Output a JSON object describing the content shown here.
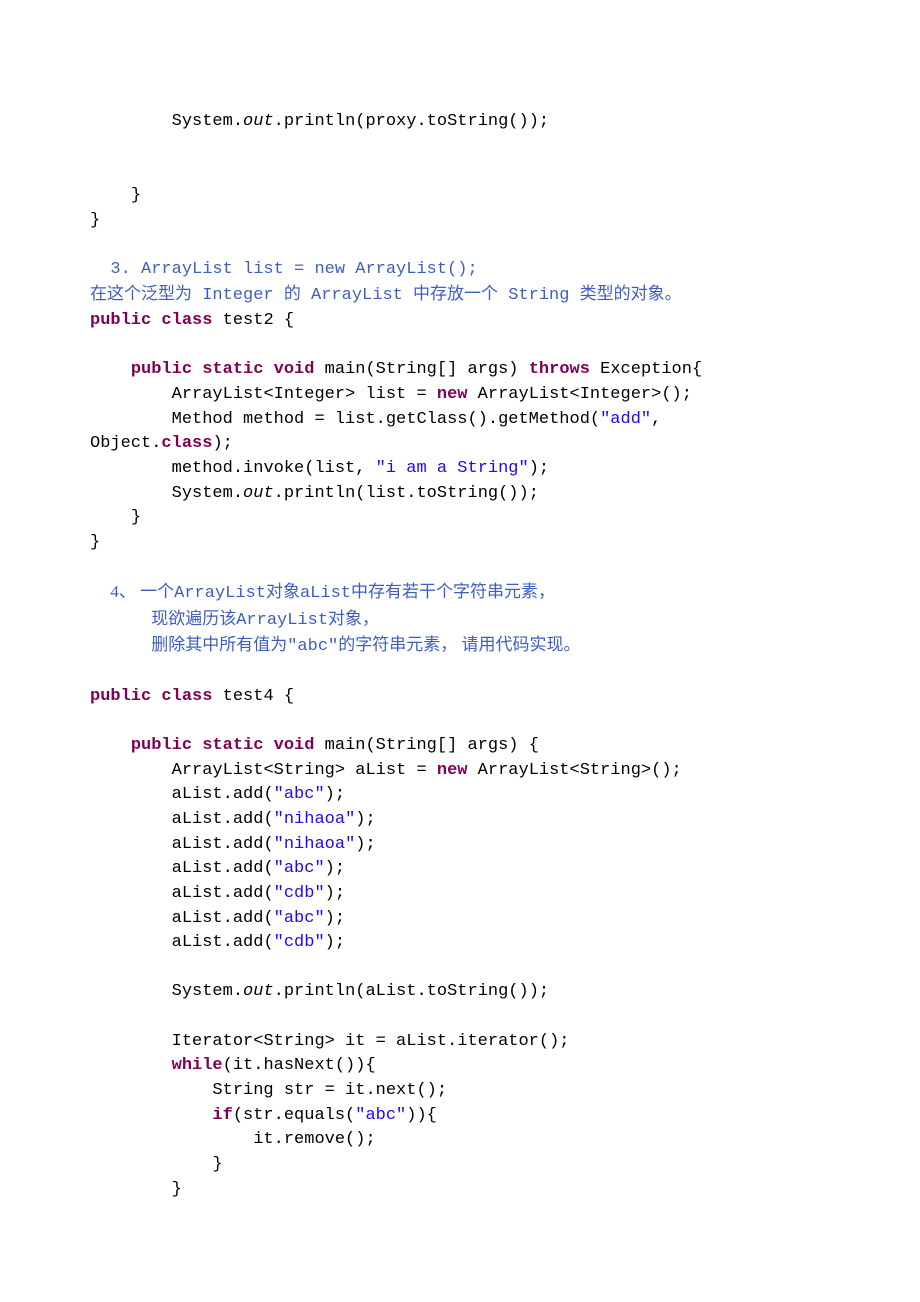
{
  "lines": [
    {
      "indent": 2,
      "parts": [
        {
          "t": "System."
        },
        {
          "t": "out",
          "cls": "it"
        },
        {
          "t": ".println(proxy.toString());"
        }
      ]
    },
    {
      "indent": 0,
      "parts": [
        {
          "t": ""
        }
      ]
    },
    {
      "indent": 0,
      "parts": [
        {
          "t": ""
        }
      ]
    },
    {
      "indent": 1,
      "parts": [
        {
          "t": "}"
        }
      ]
    },
    {
      "indent": 0,
      "parts": [
        {
          "t": "}"
        }
      ]
    },
    {
      "indent": 0,
      "parts": [
        {
          "t": ""
        }
      ]
    },
    {
      "indent": 0,
      "leading": "  ",
      "parts": [
        {
          "t": "3. ArrayList list = new ArrayList();",
          "cls": "bluecm"
        }
      ]
    },
    {
      "indent": 0,
      "mixed": true,
      "parts": [
        {
          "t": "在这个泛型为",
          "cls": "bluecm cjk"
        },
        {
          "t": " Integer ",
          "cls": "bluecm"
        },
        {
          "t": "的",
          "cls": "bluecm cjk"
        },
        {
          "t": " ArrayList ",
          "cls": "bluecm"
        },
        {
          "t": "中存放一个",
          "cls": "bluecm cjk"
        },
        {
          "t": " String ",
          "cls": "bluecm"
        },
        {
          "t": "类型的对象。",
          "cls": "bluecm cjk"
        }
      ]
    },
    {
      "indent": 0,
      "parts": [
        {
          "t": "public",
          "cls": "kw"
        },
        {
          "t": " "
        },
        {
          "t": "class",
          "cls": "kw"
        },
        {
          "t": " test2 {"
        }
      ]
    },
    {
      "indent": 0,
      "parts": [
        {
          "t": ""
        }
      ]
    },
    {
      "indent": 1,
      "parts": [
        {
          "t": "public",
          "cls": "kw"
        },
        {
          "t": " "
        },
        {
          "t": "static",
          "cls": "kw"
        },
        {
          "t": " "
        },
        {
          "t": "void",
          "cls": "kw"
        },
        {
          "t": " main(String[] args) "
        },
        {
          "t": "throws",
          "cls": "kw"
        },
        {
          "t": " Exception{"
        }
      ]
    },
    {
      "indent": 2,
      "parts": [
        {
          "t": "ArrayList<Integer> list = "
        },
        {
          "t": "new",
          "cls": "kw"
        },
        {
          "t": " ArrayList<Integer>();"
        }
      ]
    },
    {
      "indent": 2,
      "parts": [
        {
          "t": "Method method = list.getClass().getMethod("
        },
        {
          "t": "\"add\"",
          "cls": "str"
        },
        {
          "t": ", "
        }
      ]
    },
    {
      "indent": 0,
      "parts": [
        {
          "t": "Object."
        },
        {
          "t": "class",
          "cls": "kw"
        },
        {
          "t": ");"
        }
      ]
    },
    {
      "indent": 2,
      "parts": [
        {
          "t": "method.invoke(list, "
        },
        {
          "t": "\"i am a String\"",
          "cls": "str"
        },
        {
          "t": ");"
        }
      ]
    },
    {
      "indent": 2,
      "parts": [
        {
          "t": "System."
        },
        {
          "t": "out",
          "cls": "it"
        },
        {
          "t": ".println(list.toString());"
        }
      ]
    },
    {
      "indent": 1,
      "parts": [
        {
          "t": "}"
        }
      ]
    },
    {
      "indent": 0,
      "parts": [
        {
          "t": "}"
        }
      ]
    },
    {
      "indent": 0,
      "parts": [
        {
          "t": ""
        }
      ]
    },
    {
      "indent": 0,
      "leading": "  ",
      "mixed": true,
      "parts": [
        {
          "t": "4、 一个",
          "cls": "bluecm cjk"
        },
        {
          "t": "ArrayList",
          "cls": "bluecm"
        },
        {
          "t": "对象",
          "cls": "bluecm cjk"
        },
        {
          "t": "aList",
          "cls": "bluecm"
        },
        {
          "t": "中存有若干个字符串元素，",
          "cls": "bluecm cjk"
        }
      ]
    },
    {
      "indent": 0,
      "leading": "      ",
      "mixed": true,
      "parts": [
        {
          "t": "现欲遍历该",
          "cls": "bluecm cjk"
        },
        {
          "t": "ArrayList",
          "cls": "bluecm"
        },
        {
          "t": "对象，",
          "cls": "bluecm cjk"
        }
      ]
    },
    {
      "indent": 0,
      "leading": "      ",
      "mixed": true,
      "parts": [
        {
          "t": "删除其中所有值为",
          "cls": "bluecm cjk"
        },
        {
          "t": "\"abc\"",
          "cls": "bluecm"
        },
        {
          "t": "的字符串元素， 请用代码实现。",
          "cls": "bluecm cjk"
        }
      ]
    },
    {
      "indent": 0,
      "parts": [
        {
          "t": ""
        }
      ]
    },
    {
      "indent": 0,
      "parts": [
        {
          "t": "public",
          "cls": "kw"
        },
        {
          "t": " "
        },
        {
          "t": "class",
          "cls": "kw"
        },
        {
          "t": " test4 {"
        }
      ]
    },
    {
      "indent": 0,
      "parts": [
        {
          "t": ""
        }
      ]
    },
    {
      "indent": 1,
      "parts": [
        {
          "t": "public",
          "cls": "kw"
        },
        {
          "t": " "
        },
        {
          "t": "static",
          "cls": "kw"
        },
        {
          "t": " "
        },
        {
          "t": "void",
          "cls": "kw"
        },
        {
          "t": " main(String[] args) {"
        }
      ]
    },
    {
      "indent": 2,
      "parts": [
        {
          "t": "ArrayList<String> aList = "
        },
        {
          "t": "new",
          "cls": "kw"
        },
        {
          "t": " ArrayList<String>();"
        }
      ]
    },
    {
      "indent": 2,
      "parts": [
        {
          "t": "aList.add("
        },
        {
          "t": "\"abc\"",
          "cls": "str"
        },
        {
          "t": ");"
        }
      ]
    },
    {
      "indent": 2,
      "parts": [
        {
          "t": "aList.add("
        },
        {
          "t": "\"nihaoa\"",
          "cls": "str"
        },
        {
          "t": ");"
        }
      ]
    },
    {
      "indent": 2,
      "parts": [
        {
          "t": "aList.add("
        },
        {
          "t": "\"nihaoa\"",
          "cls": "str"
        },
        {
          "t": ");"
        }
      ]
    },
    {
      "indent": 2,
      "parts": [
        {
          "t": "aList.add("
        },
        {
          "t": "\"abc\"",
          "cls": "str"
        },
        {
          "t": ");"
        }
      ]
    },
    {
      "indent": 2,
      "parts": [
        {
          "t": "aList.add("
        },
        {
          "t": "\"cdb\"",
          "cls": "str"
        },
        {
          "t": ");"
        }
      ]
    },
    {
      "indent": 2,
      "parts": [
        {
          "t": "aList.add("
        },
        {
          "t": "\"abc\"",
          "cls": "str"
        },
        {
          "t": ");"
        }
      ]
    },
    {
      "indent": 2,
      "parts": [
        {
          "t": "aList.add("
        },
        {
          "t": "\"cdb\"",
          "cls": "str"
        },
        {
          "t": ");"
        }
      ]
    },
    {
      "indent": 0,
      "parts": [
        {
          "t": ""
        }
      ]
    },
    {
      "indent": 2,
      "parts": [
        {
          "t": "System."
        },
        {
          "t": "out",
          "cls": "it"
        },
        {
          "t": ".println(aList.toString());"
        }
      ]
    },
    {
      "indent": 0,
      "parts": [
        {
          "t": ""
        }
      ]
    },
    {
      "indent": 2,
      "parts": [
        {
          "t": "Iterator<String> it = aList.iterator();"
        }
      ]
    },
    {
      "indent": 2,
      "parts": [
        {
          "t": "while",
          "cls": "kw"
        },
        {
          "t": "(it.hasNext()){"
        }
      ]
    },
    {
      "indent": 3,
      "parts": [
        {
          "t": "String str = it.next();"
        }
      ]
    },
    {
      "indent": 3,
      "parts": [
        {
          "t": "if",
          "cls": "kw"
        },
        {
          "t": "(str.equals("
        },
        {
          "t": "\"abc\"",
          "cls": "str"
        },
        {
          "t": ")){"
        }
      ]
    },
    {
      "indent": 4,
      "parts": [
        {
          "t": "it.remove();"
        }
      ]
    },
    {
      "indent": 3,
      "parts": [
        {
          "t": "}"
        }
      ]
    },
    {
      "indent": 2,
      "parts": [
        {
          "t": "}"
        }
      ]
    }
  ]
}
